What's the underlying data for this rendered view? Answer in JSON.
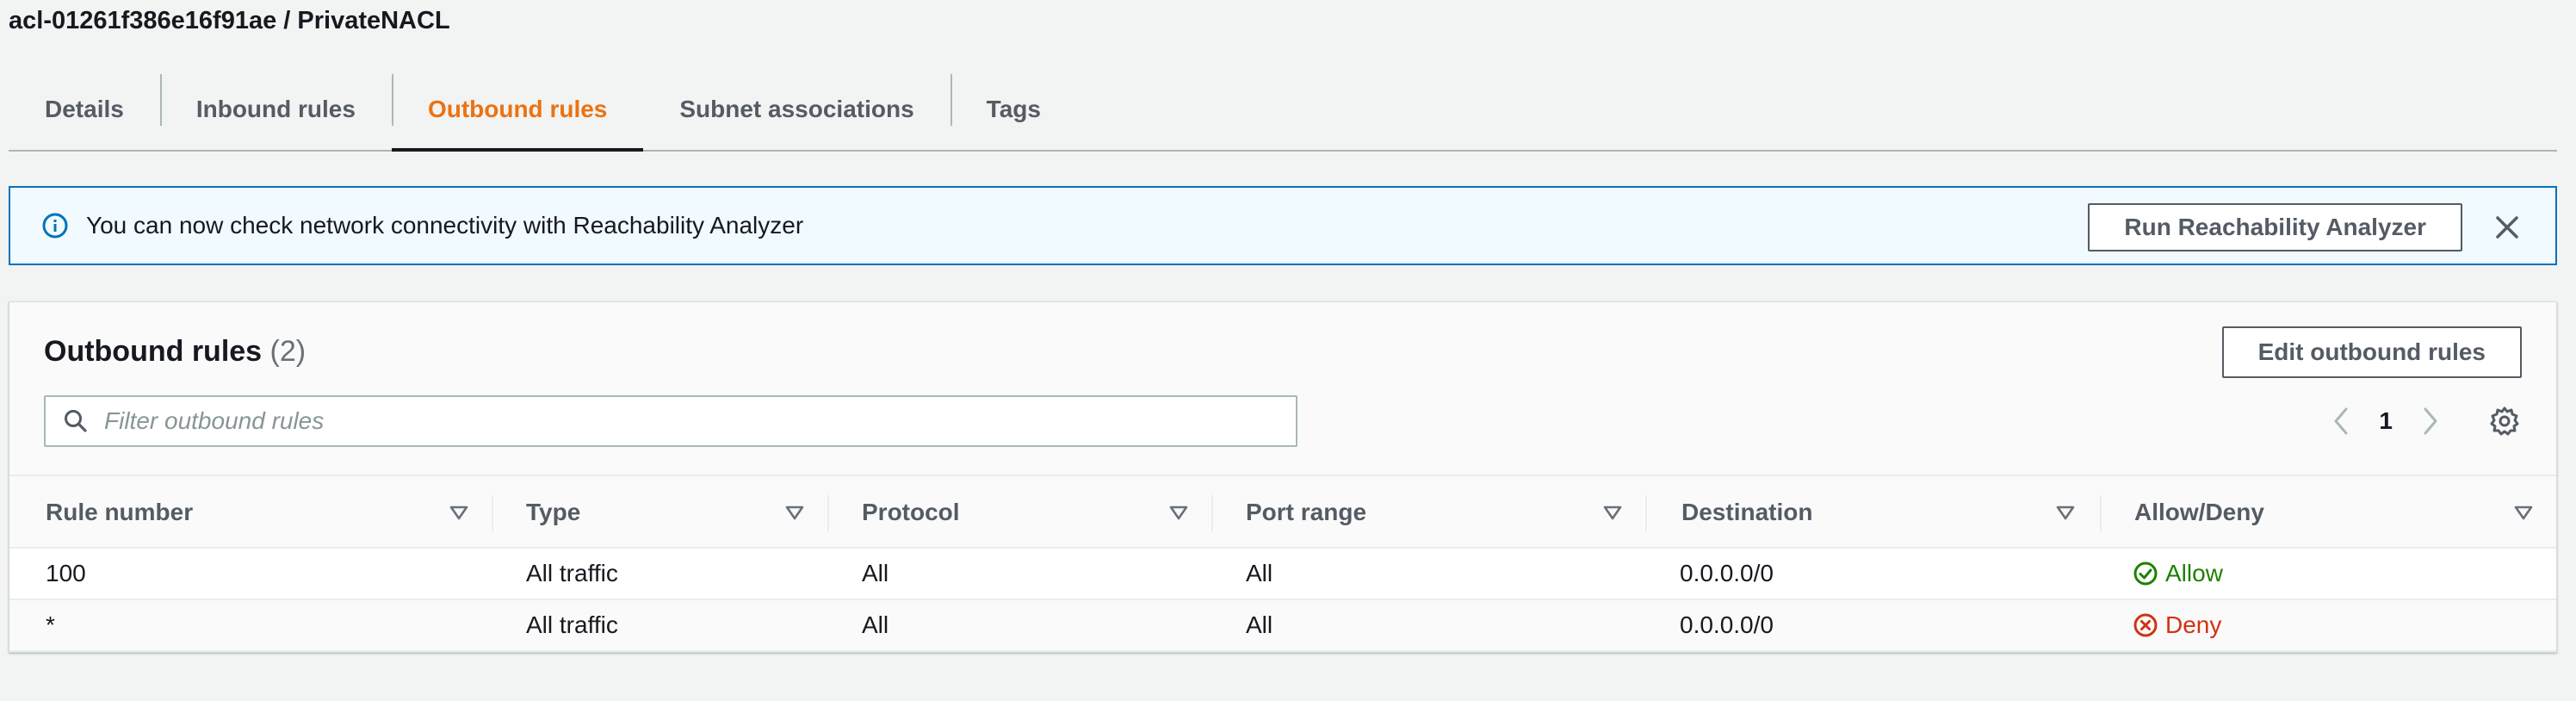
{
  "page_title": "acl-01261f386e16f91ae / PrivateNACL",
  "tabs": [
    {
      "label": "Details",
      "active": false
    },
    {
      "label": "Inbound rules",
      "active": false
    },
    {
      "label": "Outbound rules",
      "active": true
    },
    {
      "label": "Subnet associations",
      "active": false
    },
    {
      "label": "Tags",
      "active": false
    }
  ],
  "flash": {
    "icon": "info-icon",
    "message": "You can now check network connectivity with Reachability Analyzer",
    "button_label": "Run Reachability Analyzer",
    "close_icon": "close-icon"
  },
  "outbound": {
    "title": "Outbound rules",
    "count": "(2)",
    "edit_button_label": "Edit outbound rules",
    "filter_placeholder": "Filter outbound rules",
    "filter_value": "",
    "page_number": "1",
    "columns": [
      "Rule number",
      "Type",
      "Protocol",
      "Port range",
      "Destination",
      "Allow/Deny"
    ],
    "rows": [
      {
        "rule_number": "100",
        "type": "All traffic",
        "protocol": "All",
        "port_range": "All",
        "destination": "0.0.0.0/0",
        "action": "Allow",
        "status_icon": "check-circle-icon"
      },
      {
        "rule_number": "*",
        "type": "All traffic",
        "protocol": "All",
        "port_range": "All",
        "destination": "0.0.0.0/0",
        "action": "Deny",
        "status_icon": "x-circle-icon"
      }
    ]
  },
  "colors": {
    "accent_active_tab": "#ec7211",
    "info_border": "#0073bb",
    "allow": "#1d8102",
    "deny": "#d13212"
  }
}
